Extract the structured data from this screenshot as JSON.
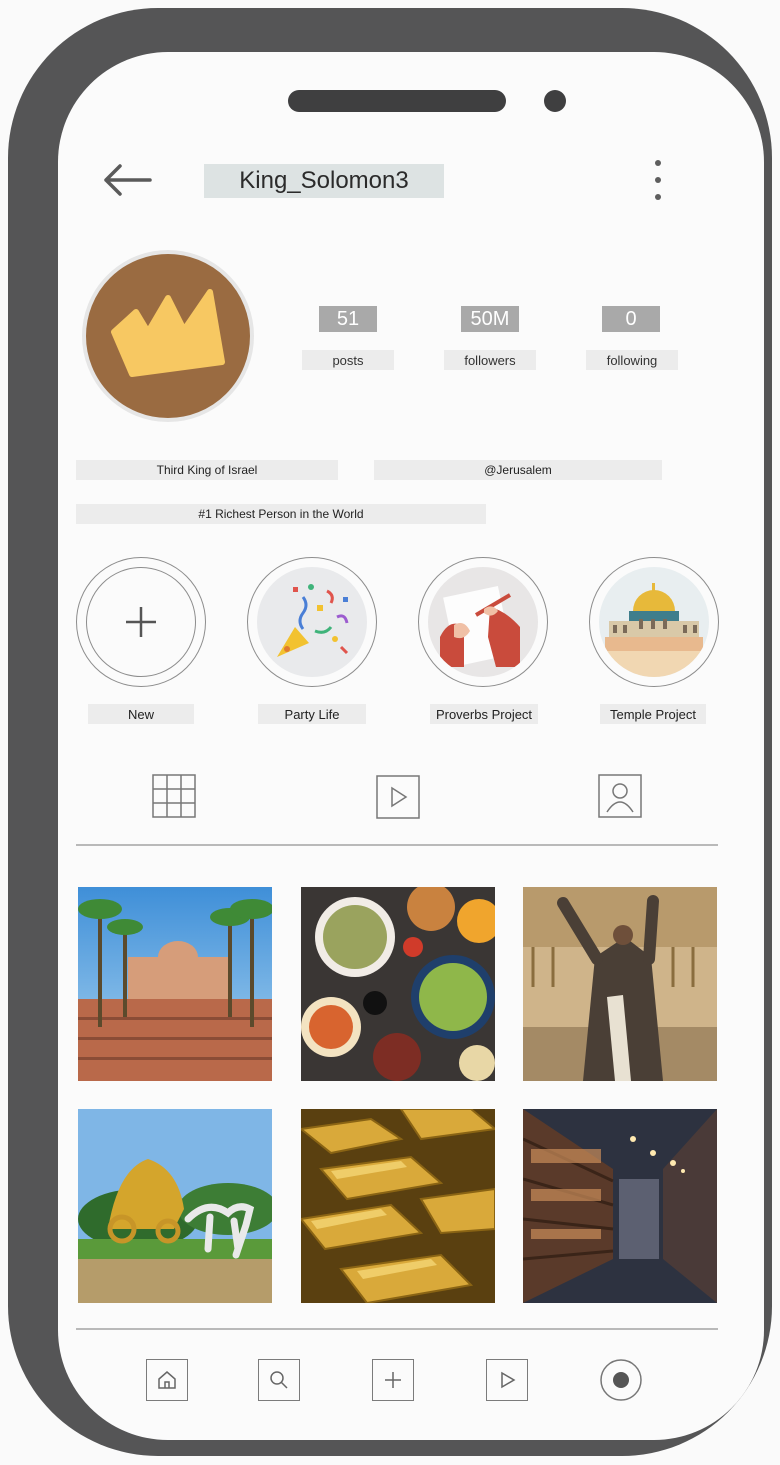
{
  "header": {
    "username": "King_Solomon3"
  },
  "stats": [
    {
      "value": "51",
      "label": "posts"
    },
    {
      "value": "50M",
      "label": "followers"
    },
    {
      "value": "0",
      "label": "following"
    }
  ],
  "bio": {
    "line1": "Third King of Israel",
    "location": "@Jerusalem",
    "line2": "#1 Richest Person in the World"
  },
  "highlights": [
    {
      "label": "New",
      "icon": "plus-icon"
    },
    {
      "label": "Party Life",
      "icon": "confetti-icon"
    },
    {
      "label": "Proverbs Project",
      "icon": "writing-hand-icon"
    },
    {
      "label": "Temple Project",
      "icon": "temple-dome-icon"
    }
  ],
  "content_tabs": [
    "grid-icon",
    "reels-play-icon",
    "tagged-person-icon"
  ],
  "posts": [
    {
      "icon": "palace-photo"
    },
    {
      "icon": "feast-food-photo"
    },
    {
      "icon": "king-praying-temple-photo"
    },
    {
      "icon": "golden-chariot-photo"
    },
    {
      "icon": "gold-bars-photo"
    },
    {
      "icon": "library-bookshelves-photo"
    }
  ],
  "bottom_nav": [
    "home-icon",
    "search-icon",
    "add-post-icon",
    "reels-play-icon",
    "profile-icon"
  ],
  "colors": {
    "phone_frame": "#555556",
    "avatar_bg": "#9a6b41",
    "crown": "#f7c862"
  }
}
